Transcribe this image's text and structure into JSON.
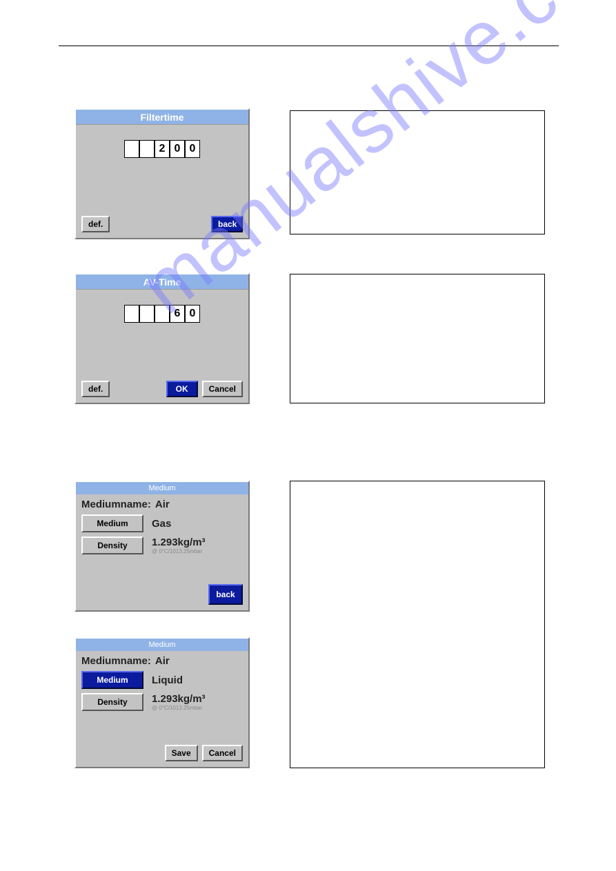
{
  "filtertime": {
    "title": "Filtertime",
    "digits": [
      "",
      "",
      "2",
      "0",
      "0"
    ],
    "def": "def.",
    "back": "back"
  },
  "avtime": {
    "title": "AV-Time",
    "digits": [
      "",
      "",
      "",
      "6",
      "0"
    ],
    "def": "def.",
    "ok": "OK",
    "cancel": "Cancel"
  },
  "medium1": {
    "title": "Medium",
    "name_label": "Mediumname:",
    "name_value": "Air",
    "medium_btn": "Medium",
    "medium_value": "Gas",
    "density_btn": "Density",
    "density_value": "1.293kg/m³",
    "density_sub": "@ 0°C/1013.25mbar",
    "back": "back"
  },
  "medium2": {
    "title": "Medium",
    "name_label": "Mediumname:",
    "name_value": "Air",
    "medium_btn": "Medium",
    "medium_value": "Liquid",
    "density_btn": "Density",
    "density_value": "1.293kg/m³",
    "density_sub": "@ 0°C/1013.25mbar",
    "save": "Save",
    "cancel": "Cancel"
  },
  "watermark": "manualshive.com"
}
